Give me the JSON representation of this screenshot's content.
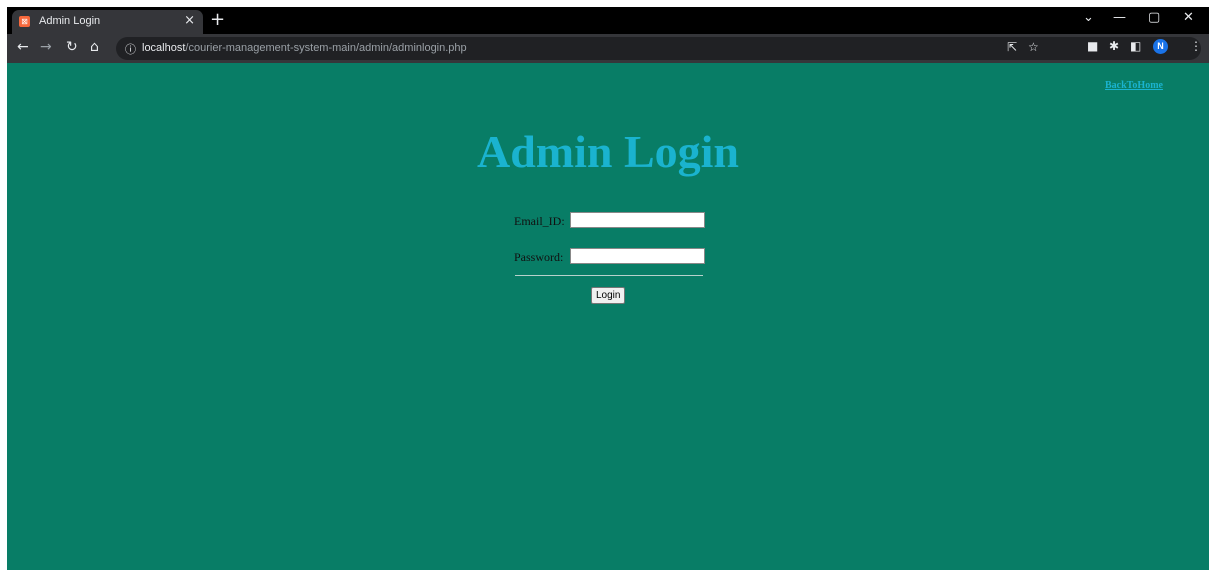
{
  "browser": {
    "tab_title": "Admin Login",
    "tab_close": "×",
    "new_tab": "+",
    "url_host": "localhost",
    "url_path": "/courier-management-system-main/admin/adminlogin.php",
    "profile_initial": "N",
    "icons": [
      "back-icon",
      "forward-icon",
      "reload-icon",
      "home-icon",
      "site-info-icon",
      "share-icon",
      "bookmark-star-icon",
      "extension-icon",
      "puzzle-icon",
      "side-panel-icon",
      "menu-icon"
    ]
  },
  "page": {
    "back_link": "BackToHome",
    "title": "Admin Login",
    "email_label": "Email_ID:",
    "email_value": "",
    "password_label": "Password:",
    "password_value": "",
    "login_button": "Login"
  },
  "colors": {
    "background": "#087d66",
    "title": "#1ab3cf",
    "link": "#1ab3cf"
  }
}
